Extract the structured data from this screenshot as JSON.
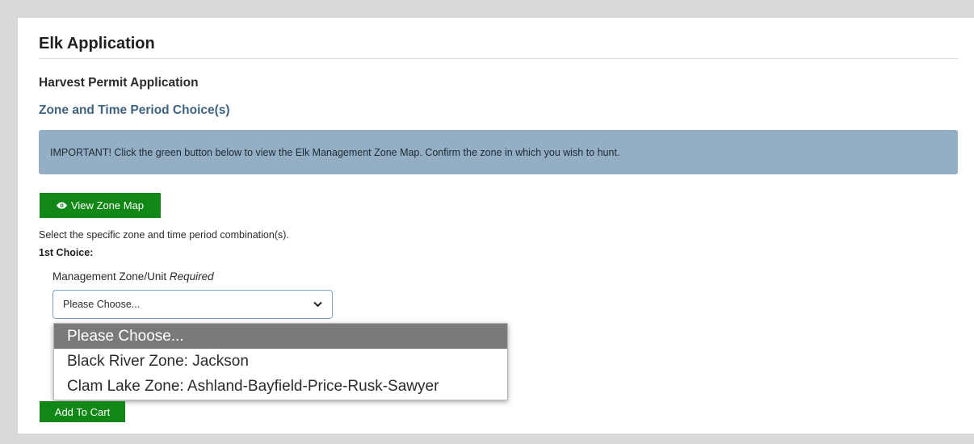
{
  "page": {
    "title": "Elk Application",
    "subtitle": "Harvest Permit Application",
    "section_heading": "Zone and Time Period Choice(s)"
  },
  "alert": {
    "text": "IMPORTANT! Click the green button below to view the Elk Management Zone Map. Confirm the zone in which you wish to hunt."
  },
  "view_map_button": {
    "label": "View Zone Map",
    "icon": "eye-icon"
  },
  "instructions": "Select the specific zone and time period combination(s).",
  "choice": {
    "label": "1st Choice:",
    "field_label": "Management Zone/Unit",
    "required_text": "Required",
    "selected": "Please Choose...",
    "options": [
      "Please Choose...",
      "Black River Zone: Jackson",
      "Clam Lake Zone: Ashland-Bayfield-Price-Rusk-Sawyer"
    ]
  },
  "add_to_cart_button": {
    "label": "Add To Cart"
  },
  "colors": {
    "button_green": "#118716",
    "alert_bg": "#94afc3",
    "heading_blue": "#3f6381",
    "option_highlight": "#7a7a7a"
  }
}
